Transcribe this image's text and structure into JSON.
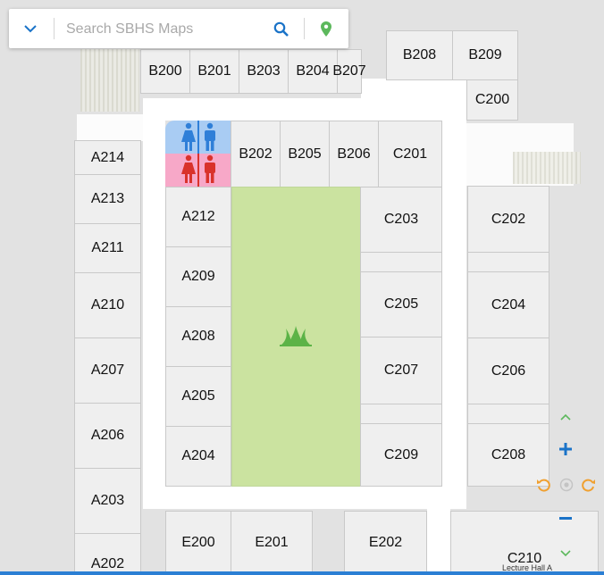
{
  "search": {
    "placeholder": "Search SBHS Maps"
  },
  "rooms": {
    "B200": "B200",
    "B201": "B201",
    "B203": "B203",
    "B204": "B204",
    "B207": "B207",
    "B208": "B208",
    "B209": "B209",
    "C200": "C200",
    "B202": "B202",
    "B205": "B205",
    "B206": "B206",
    "C201": "C201",
    "A214": "A214",
    "A213": "A213",
    "A211": "A211",
    "A210": "A210",
    "A207": "A207",
    "A206": "A206",
    "A203": "A203",
    "A202": "A202",
    "A212": "A212",
    "A209": "A209",
    "A208": "A208",
    "A205": "A205",
    "A204": "A204",
    "C203": "C203",
    "C205": "C205",
    "C207": "C207",
    "C209": "C209",
    "C202": "C202",
    "C204": "C204",
    "C206": "C206",
    "C208": "C208",
    "E200": "E200",
    "E201": "E201",
    "E202": "E202",
    "C210": "C210"
  },
  "labels": {
    "lecture_hall": "Lecture Hall A"
  },
  "colors": {
    "accent": "#1a73c8",
    "pin": "#5cb85c",
    "orange": "#f0a030",
    "chevron_green": "#5cb85c",
    "restroom_women": "#f7a8c8",
    "restroom_men": "#a9ccf3",
    "restroom_icon_blue": "#2f7fd8",
    "restroom_icon_red": "#d9322b",
    "courtyard": "#cbe3a0",
    "grass": "#5cb347"
  },
  "icons": {
    "dropdown": "chevron-down-icon",
    "search": "search-icon",
    "location": "map-pin-icon",
    "women": "women-restroom-icon",
    "men": "men-restroom-icon",
    "grass": "grass-icon",
    "zoom_in": "plus-icon",
    "zoom_out": "minus-icon",
    "rotate_left": "rotate-left-icon",
    "rotate_right": "rotate-right-icon",
    "reset": "compass-reset-icon",
    "pan_up": "chevron-up-icon",
    "pan_down": "chevron-down-icon"
  }
}
